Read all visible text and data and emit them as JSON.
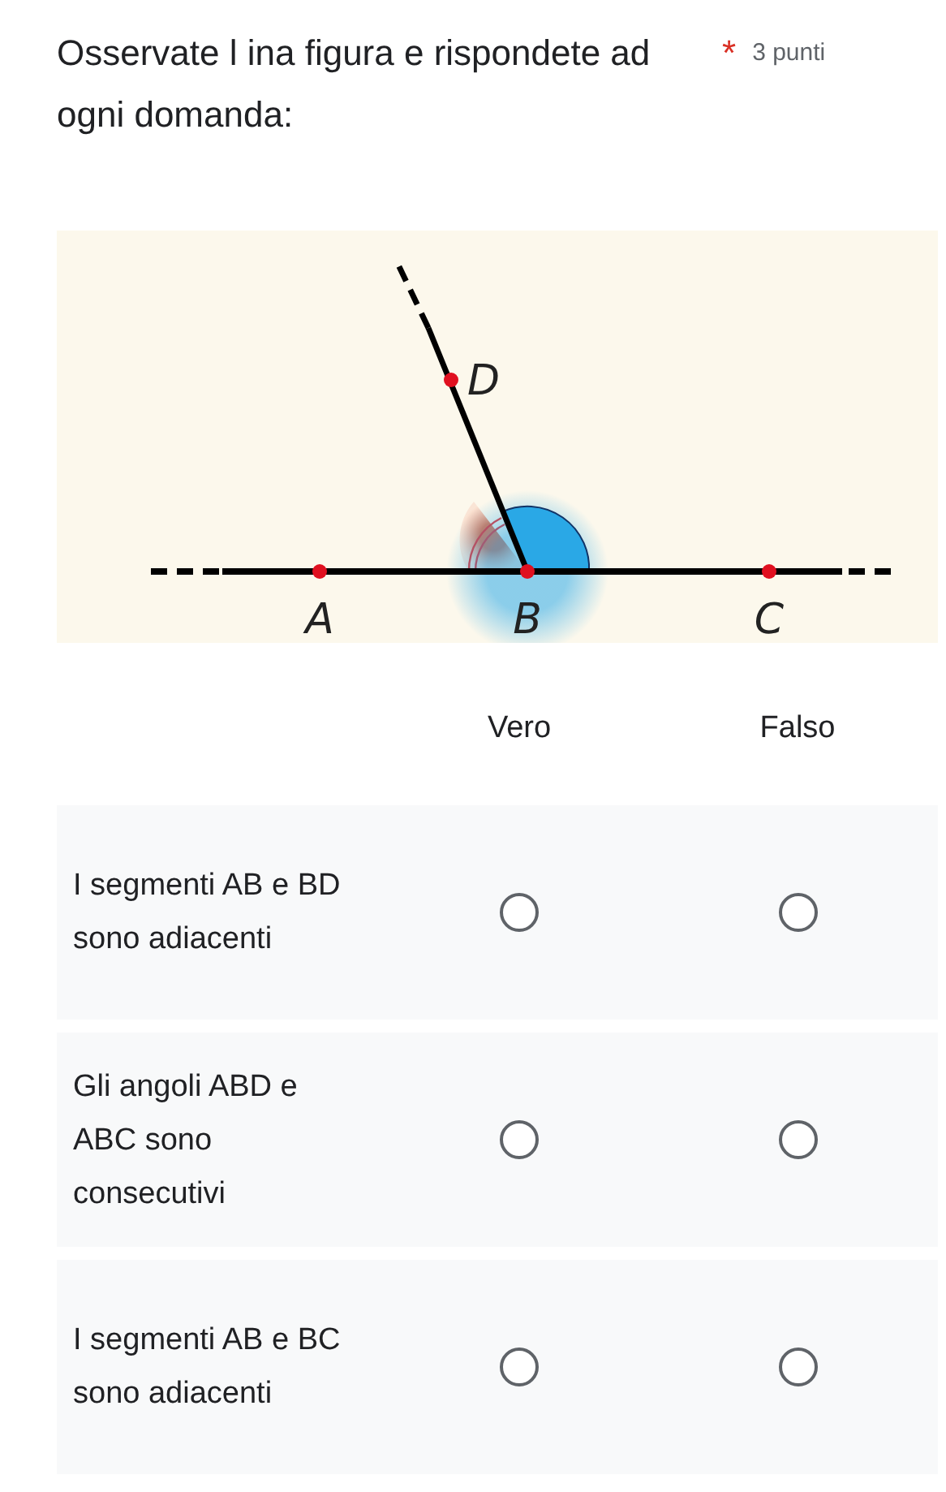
{
  "question": {
    "title": "Osservate l ina figura e rispondete ad ogni domanda:",
    "required_mark": "*",
    "points": "3 punti"
  },
  "figure": {
    "labels": [
      "D",
      "A",
      "B",
      "C"
    ]
  },
  "grid": {
    "columns": [
      "Vero",
      "Falso"
    ],
    "rows": [
      {
        "label": "I segmenti AB e BD sono adiacenti",
        "selected": [
          false,
          false
        ]
      },
      {
        "label": "Gli angoli ABD e ABC sono consecutivi",
        "selected": [
          false,
          false
        ]
      },
      {
        "label": "I segmenti AB e BC sono adiacenti",
        "selected": [
          false,
          false
        ]
      }
    ]
  }
}
